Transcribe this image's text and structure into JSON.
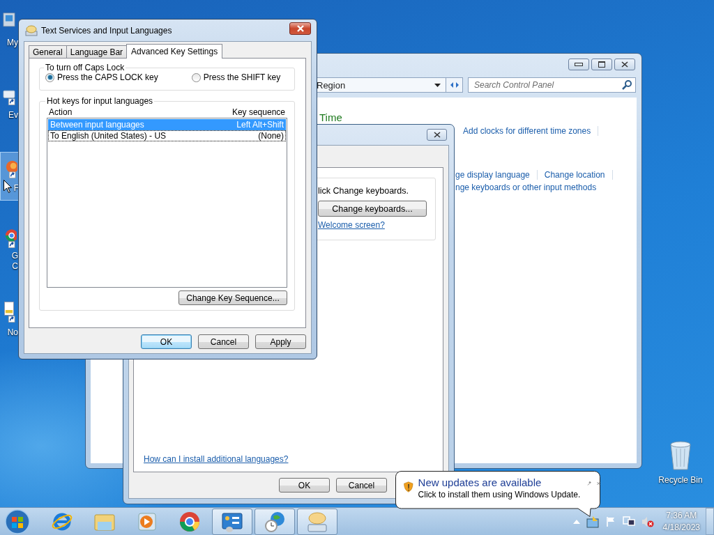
{
  "desktop_icons": [
    {
      "kind": "computer",
      "label": "My",
      "selected": false
    },
    {
      "kind": "app",
      "label": "Ev",
      "selected": false
    },
    {
      "kind": "firefox",
      "label": "F",
      "selected": true
    },
    {
      "kind": "chrome",
      "label": "G\nC",
      "selected": false
    },
    {
      "kind": "notepad",
      "label": "No",
      "selected": false
    }
  ],
  "recycle_bin": {
    "label": "Recycle Bin"
  },
  "control_panel": {
    "address": "Region",
    "search_placeholder": "Search Control Panel",
    "heading": "Time",
    "link_rows": [
      [
        "Add clocks for different time zones"
      ],
      [
        "ge display language",
        "Change location"
      ],
      [
        "nge keyboards or other input methods"
      ]
    ]
  },
  "region_dialog": {
    "instruction": "lick Change keyboards.",
    "change_button": "Change keyboards...",
    "welcome_link": "Welcome screen?",
    "install_link": "How can I install additional languages?",
    "buttons": [
      "OK",
      "Cancel"
    ]
  },
  "text_services": {
    "title": "Text Services and Input Languages",
    "tabs": [
      {
        "label": "General",
        "selected": false
      },
      {
        "label": "Language Bar",
        "selected": false
      },
      {
        "label": "Advanced Key Settings",
        "selected": true
      }
    ],
    "caps_group": "To turn off Caps Lock",
    "caps_options": [
      {
        "label": "Press the CAPS LOCK key",
        "selected": true
      },
      {
        "label": "Press the SHIFT key",
        "selected": false
      }
    ],
    "hotkeys_group": "Hot keys for input languages",
    "columns": [
      "Action",
      "Key sequence"
    ],
    "rows": [
      {
        "action": "Between input languages",
        "sequence": "Left Alt+Shift",
        "selected": true,
        "focused": false
      },
      {
        "action": "To English (United States) - US",
        "sequence": "(None)",
        "selected": false,
        "focused": true
      }
    ],
    "change_button": "Change Key Sequence...",
    "buttons": [
      {
        "label": "OK",
        "default": true
      },
      {
        "label": "Cancel",
        "default": false
      },
      {
        "label": "Apply",
        "default": false
      }
    ]
  },
  "balloon": {
    "title": "New updates are available",
    "text": "Click to install them using Windows Update."
  },
  "taskbar": {
    "items": [
      {
        "kind": "ie",
        "open": false
      },
      {
        "kind": "folder",
        "open": false
      },
      {
        "kind": "media",
        "open": false
      },
      {
        "kind": "chrome",
        "open": false
      },
      {
        "kind": "control-panel",
        "open": true
      },
      {
        "kind": "clock-globe",
        "open": true
      },
      {
        "kind": "keyboard",
        "open": true
      }
    ],
    "time": "7:36 AM",
    "date": "4/18/2023"
  }
}
